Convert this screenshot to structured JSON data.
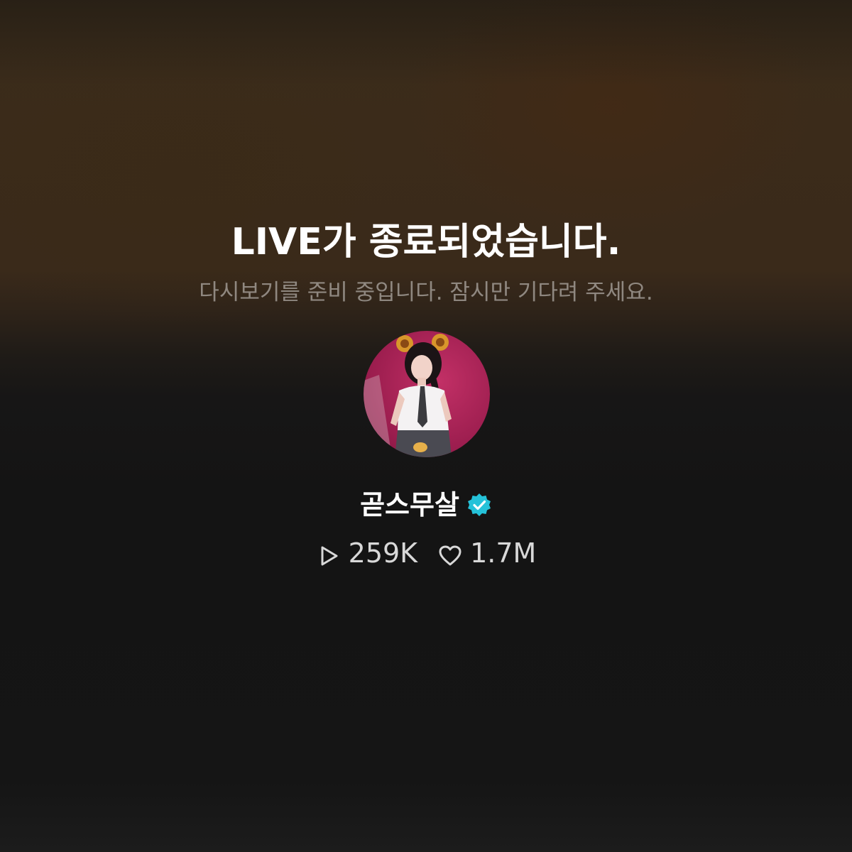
{
  "live_end": {
    "title": "LIVE가 종료되었습니다.",
    "subtitle": "다시보기를 준비 중입니다. 잠시만 기다려 주세요."
  },
  "creator": {
    "name": "곧스무살",
    "verified": true,
    "verified_icon": "verified-badge-icon",
    "verified_color": "#25c2d9"
  },
  "stats": {
    "views": "259K",
    "views_icon": "play-icon",
    "likes": "1.7M",
    "likes_icon": "heart-icon"
  }
}
